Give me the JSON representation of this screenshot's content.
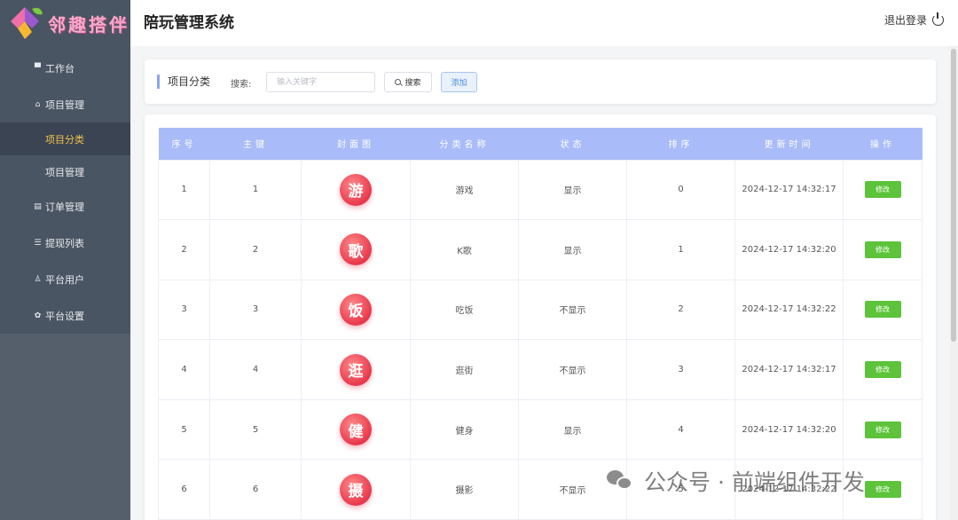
{
  "app": {
    "logo_text": "邻趣搭伴",
    "title": "陪玩管理系统",
    "logout_label": "退出登录",
    "colors": {
      "sidebar": "#4a5563",
      "active_text": "#f2c34a",
      "table_header": "#a9bbf8",
      "edit_button": "#5cc33a",
      "cover": "#e8384c"
    }
  },
  "sidebar": {
    "items": [
      {
        "label": "工作台",
        "icon": "monitor-icon"
      },
      {
        "label": "项目管理",
        "icon": "home-icon"
      },
      {
        "label": "项目分类",
        "sub": true,
        "active": true
      },
      {
        "label": "项目管理",
        "sub": true
      },
      {
        "label": "订单管理",
        "icon": "document-icon"
      },
      {
        "label": "提现列表",
        "icon": "database-icon"
      },
      {
        "label": "平台用户",
        "icon": "user-icon"
      },
      {
        "label": "平台设置",
        "icon": "gear-icon"
      }
    ]
  },
  "filter": {
    "title": "项目分类",
    "search_label": "搜索:",
    "search_placeholder": "输入关键字",
    "search_button": "搜索",
    "add_button": "添加"
  },
  "table": {
    "headers": [
      "序号",
      "主键",
      "封面图",
      "分类名称",
      "状态",
      "排序",
      "更新时间",
      "操作"
    ],
    "edit_label": "修改",
    "rows": [
      {
        "index": "1",
        "id": "1",
        "cover": "游",
        "name": "游戏",
        "status": "显示",
        "sort": "0",
        "updated": "2024-12-17 14:32:17"
      },
      {
        "index": "2",
        "id": "2",
        "cover": "歌",
        "name": "K歌",
        "status": "显示",
        "sort": "1",
        "updated": "2024-12-17 14:32:20"
      },
      {
        "index": "3",
        "id": "3",
        "cover": "饭",
        "name": "吃饭",
        "status": "不显示",
        "sort": "2",
        "updated": "2024-12-17 14:32:22"
      },
      {
        "index": "4",
        "id": "4",
        "cover": "逛",
        "name": "逛街",
        "status": "不显示",
        "sort": "3",
        "updated": "2024-12-17 14:32:17"
      },
      {
        "index": "5",
        "id": "5",
        "cover": "健",
        "name": "健身",
        "status": "显示",
        "sort": "4",
        "updated": "2024-12-17 14:32:20"
      },
      {
        "index": "6",
        "id": "6",
        "cover": "摄",
        "name": "摄影",
        "status": "不显示",
        "sort": "5",
        "updated": "2024-12-17 14:32:22"
      }
    ]
  },
  "watermark": {
    "text": "公众号 · 前端组件开发",
    "icon": "wechat-icon"
  }
}
